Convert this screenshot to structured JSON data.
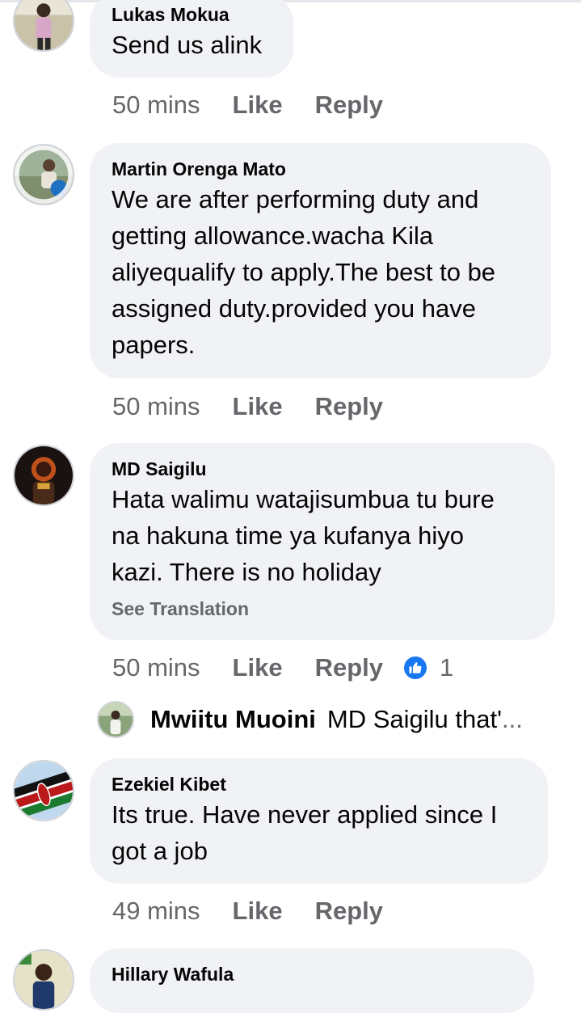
{
  "comments": [
    {
      "author": "Lukas Mokua",
      "text_lines": [
        "Send us alink"
      ],
      "time": "50 mins",
      "like": "Like",
      "reply": "Reply",
      "avatar_icon": "user-avatar-icon"
    },
    {
      "author": "Martin Orenga Mato",
      "text_lines": [
        "We are after performing duty and",
        "getting allowance.wacha Kila",
        "aliyequalify to apply.The best to be",
        "assigned duty.provided you have",
        "papers."
      ],
      "time": "50 mins",
      "like": "Like",
      "reply": "Reply",
      "avatar_icon": "user-avatar-icon"
    },
    {
      "author": "MD Saigilu",
      "text_lines": [
        "Hata walimu watajisumbua tu bure",
        "na hakuna time ya kufanya hiyo",
        "kazi. There is no holiday"
      ],
      "see_translation": "See Translation",
      "time": "50 mins",
      "like": "Like",
      "reply": "Reply",
      "reaction_count": "1",
      "reaction_icon": "thumbs-up-icon",
      "avatar_icon": "user-avatar-icon"
    },
    {
      "author": "Ezekiel Kibet",
      "text_lines": [
        "Its true. Have never applied since I",
        "got a job"
      ],
      "time": "49 mins",
      "like": "Like",
      "reply": "Reply",
      "avatar_icon": "kenya-flag-avatar-icon"
    },
    {
      "author": "Hillary Wafula",
      "avatar_icon": "user-avatar-icon"
    }
  ],
  "reply_preview": {
    "author": "Mwiitu Muoini",
    "text": "MD Saigilu that'",
    "ellipsis": "...",
    "avatar_icon": "user-avatar-icon"
  },
  "colors": {
    "bubble": "#f0f2f5",
    "secondary_text": "#65676b",
    "like_blue": "#1877f2"
  }
}
